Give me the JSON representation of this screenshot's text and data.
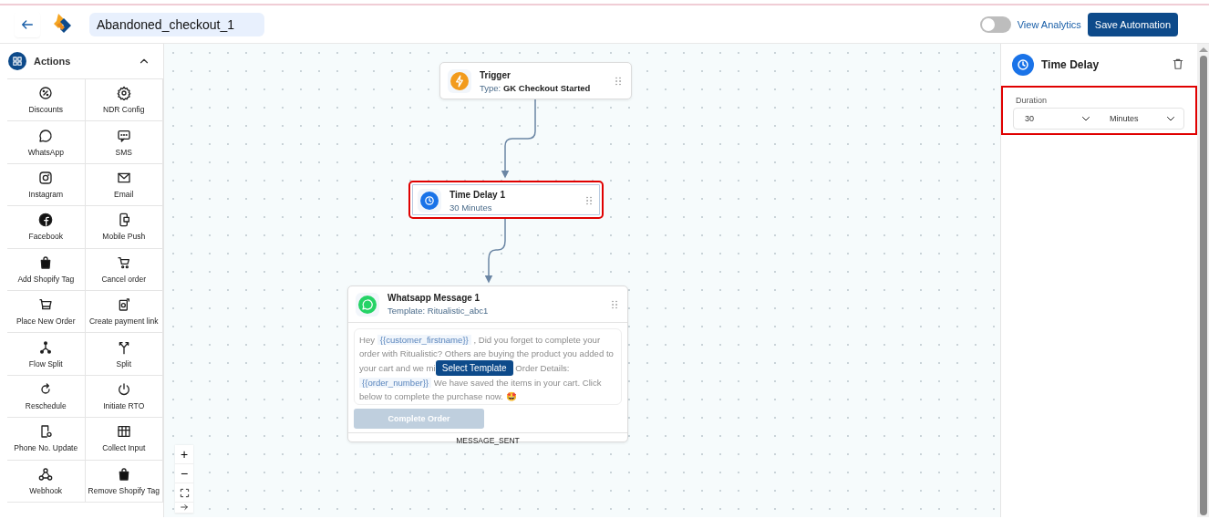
{
  "header": {
    "flow_name": "Abandoned_checkout_1",
    "analytics_toggle": {
      "label": "View Analytics",
      "on": false
    },
    "save_button": "Save Automation"
  },
  "sidebar": {
    "title": "Actions",
    "expanded": true,
    "items": [
      {
        "label": "Discounts"
      },
      {
        "label": "NDR Config"
      },
      {
        "label": "WhatsApp"
      },
      {
        "label": "SMS"
      },
      {
        "label": "Instagram"
      },
      {
        "label": "Email"
      },
      {
        "label": "Facebook"
      },
      {
        "label": "Mobile Push"
      },
      {
        "label": "Add Shopify Tag"
      },
      {
        "label": "Cancel order"
      },
      {
        "label": "Place New Order"
      },
      {
        "label": "Create payment link"
      },
      {
        "label": "Flow Split"
      },
      {
        "label": "Split"
      },
      {
        "label": "Reschedule"
      },
      {
        "label": "Initiate RTO"
      },
      {
        "label": "Phone No. Update"
      },
      {
        "label": "Collect Input"
      },
      {
        "label": "Webhook"
      },
      {
        "label": "Remove Shopify Tag"
      }
    ]
  },
  "canvas": {
    "nodes": [
      {
        "kind": "trigger",
        "title": "Trigger",
        "subtitle_label": "Type:",
        "subtitle": "GK Checkout Started",
        "highlighted": false
      },
      {
        "kind": "delay",
        "title": "Time Delay 1",
        "subtitle": "30 Minutes",
        "highlighted": true
      },
      {
        "kind": "whatsapp",
        "title": "Whatsapp Message 1",
        "subtitle": "Template: Ritualistic_abc1",
        "highlighted": false,
        "message": [
          {
            "kind": "text",
            "text": "Hey "
          },
          {
            "kind": "variable",
            "text": "{{customer_firstname}}"
          },
          {
            "kind": "text",
            "text": " , Did you forget to complete your order with Ritualistic? Others are buying the product you added to your cart and we mi"
          },
          {
            "kind": "button",
            "text": "Select Template"
          },
          {
            "kind": "text",
            "text": " Order Details: "
          },
          {
            "kind": "variable",
            "text": "{{order_number}}"
          },
          {
            "kind": "text",
            "text": " We have saved the items in your cart. Click below to complete the purchase now. 🤩"
          }
        ],
        "cta": "Complete Order",
        "output": "MESSAGE_SENT"
      }
    ],
    "zoom_controls": [
      {
        "kind": "zoom-in",
        "text": "+"
      },
      {
        "kind": "zoom-out",
        "text": "−"
      },
      {
        "kind": "fit"
      },
      {
        "kind": "more"
      }
    ]
  },
  "panel": {
    "title": "Time Delay",
    "field_label": "Duration",
    "highlighted": true,
    "amount": "30",
    "unit": "Minutes"
  }
}
